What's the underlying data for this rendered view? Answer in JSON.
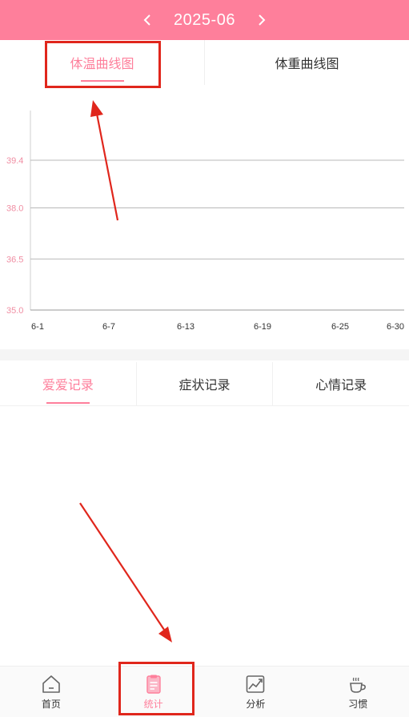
{
  "header": {
    "month": "2025-06",
    "prev_icon": "chevron-left-icon",
    "next_icon": "chevron-right-icon",
    "bg_color": "#fe7f9b"
  },
  "chart_tabs": [
    {
      "label": "体温曲线图",
      "active": true
    },
    {
      "label": "体重曲线图",
      "active": false
    }
  ],
  "chart_data": {
    "type": "line",
    "x_ticks": [
      "6-1",
      "6-7",
      "6-13",
      "6-19",
      "6-25",
      "6-30"
    ],
    "y_ticks": [
      "35.0",
      "36.5",
      "38.0",
      "39.4"
    ],
    "ylim": [
      35.0,
      39.4
    ],
    "grid": true,
    "series": []
  },
  "record_tabs": [
    {
      "label": "爱爱记录",
      "active": true
    },
    {
      "label": "症状记录",
      "active": false
    },
    {
      "label": "心情记录",
      "active": false
    }
  ],
  "bottom_nav": [
    {
      "label": "首页",
      "icon": "home-icon",
      "active": false
    },
    {
      "label": "统计",
      "icon": "clipboard-icon",
      "active": true
    },
    {
      "label": "分析",
      "icon": "trend-chart-icon",
      "active": false
    },
    {
      "label": "习惯",
      "icon": "coffee-cup-icon",
      "active": false
    }
  ],
  "colors": {
    "accent": "#fe7f9b",
    "annotation": "#e0261c"
  }
}
